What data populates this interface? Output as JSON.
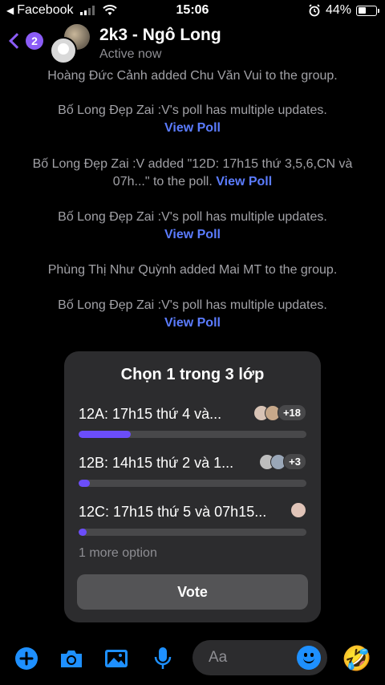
{
  "status": {
    "carrier": "Facebook",
    "time": "15:06",
    "battery": "44%",
    "battery_level": 0.44
  },
  "header": {
    "badge": "2",
    "title": "2k3 - Ngô Long",
    "subtitle": "Active now"
  },
  "messages": [
    {
      "text": "Hoàng Đức Cảnh added Chu Văn Vui to the group.",
      "link": ""
    },
    {
      "text": "Bố Long Đẹp Zai :V's poll has multiple updates.",
      "link": "View Poll"
    },
    {
      "text": "Bố Long Đẹp Zai :V added \"12D: 17h15 thứ 3,5,6,CN và 07h...\" to the poll.",
      "link": "View Poll"
    },
    {
      "text": "Bố Long Đẹp Zai :V's poll has multiple updates.",
      "link": "View Poll"
    },
    {
      "text": "Phùng Thị Như Quỳnh added Mai MT to the group.",
      "link": ""
    },
    {
      "text": "Bố Long Đẹp Zai :V's poll has multiple updates.",
      "link": "View Poll"
    }
  ],
  "poll": {
    "title": "Chọn 1 trong 3 lớp",
    "options": [
      {
        "label": "12A: 17h15 thứ 4 và...",
        "count": "+18",
        "fill": 0.23
      },
      {
        "label": "12B: 14h15 thứ 2 và 1...",
        "count": "+3",
        "fill": 0.05
      },
      {
        "label": "12C: 17h15 thứ 5 và 07h15...",
        "count": "",
        "fill": 0.035
      }
    ],
    "more": "1 more option",
    "vote": "Vote"
  },
  "composer": {
    "placeholder": "Aa"
  },
  "colors": {
    "accent": "#8b5cf6",
    "link": "#5b7cff",
    "bar_fill": "#6b4dfa",
    "icon_blue": "#1e90ff"
  }
}
